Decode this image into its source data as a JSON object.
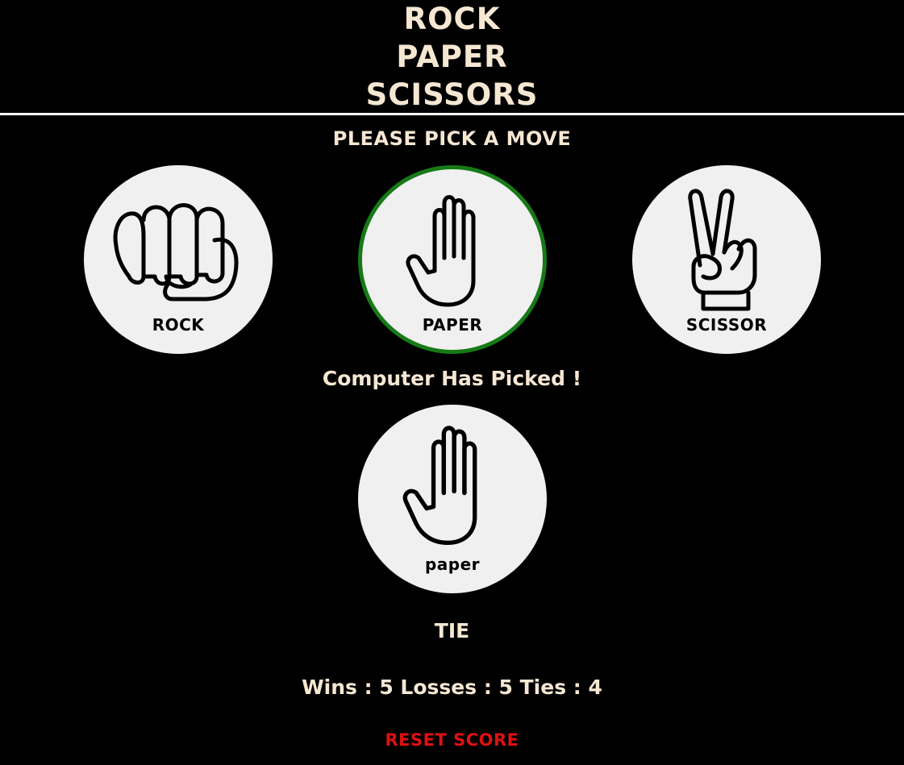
{
  "title": {
    "line1": "ROCK",
    "line2": "PAPER",
    "line3": "SCISSORS"
  },
  "pick_heading": "PLEASE PICK A MOVE",
  "moves": [
    {
      "label": "ROCK",
      "icon": "fist-icon",
      "selected": false
    },
    {
      "label": "PAPER",
      "icon": "open-hand-icon",
      "selected": true
    },
    {
      "label": "SCISSOR",
      "icon": "peace-sign-icon",
      "selected": false
    }
  ],
  "computer_heading": "Computer Has Picked !",
  "computer_pick": {
    "label": "paper",
    "icon": "open-hand-icon"
  },
  "result": "TIE",
  "score": "Wins : 5 Losses : 5 Ties : 4",
  "reset_label": "RESET SCORE",
  "colors": {
    "background": "#000000",
    "text": "#f6e7d3",
    "circle": "#f0f0f0",
    "selected_border": "#177a17",
    "reset": "#e01010"
  }
}
